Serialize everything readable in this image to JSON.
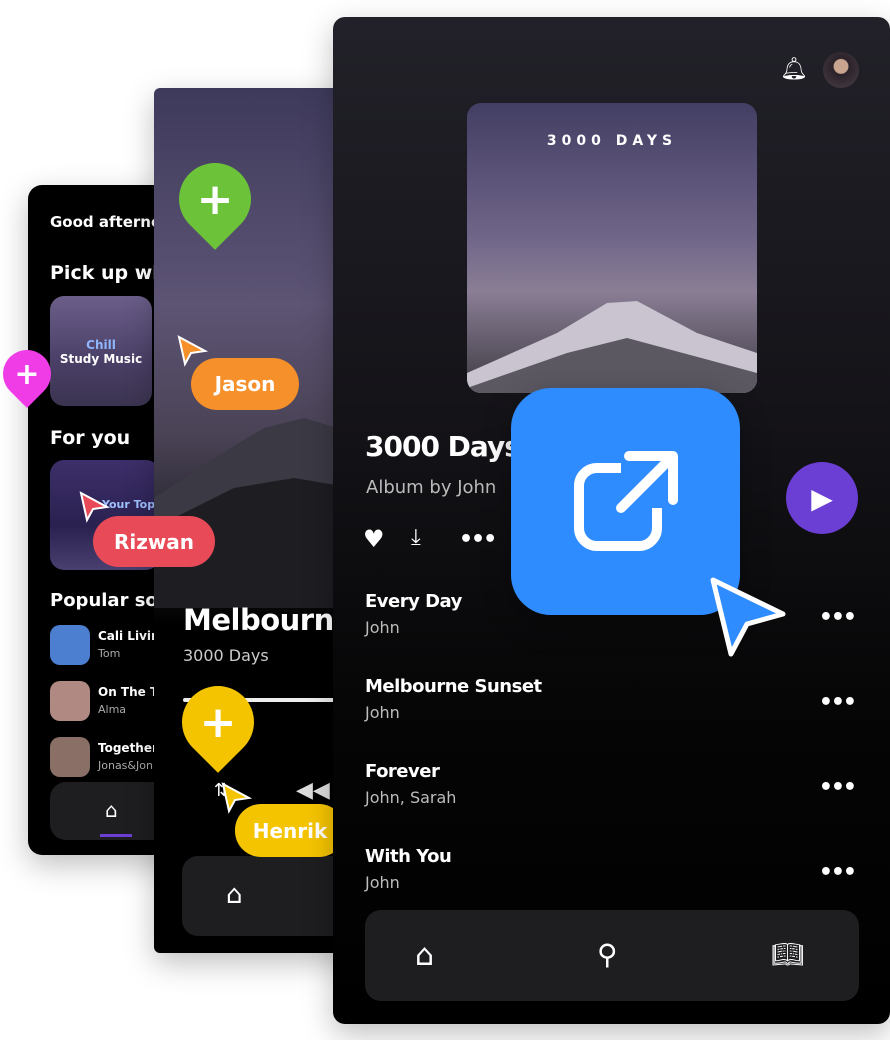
{
  "left_screen": {
    "greeting": "Good afternoon",
    "section_resume": "Pick up where you left off",
    "card_chill_line1": "Chill",
    "card_chill_line2": "Study Music",
    "section_for_you": "For you",
    "card_top": "Your Top",
    "section_popular": "Popular songs",
    "songs": [
      {
        "title": "Cali Living",
        "artist": "Tom"
      },
      {
        "title": "On The Top",
        "artist": "Alma"
      },
      {
        "title": "Together",
        "artist": "Jonas&Jon"
      }
    ],
    "nav_icon": "home-icon"
  },
  "mid_screen": {
    "title": "Melbourne Sunset",
    "subtitle": "3000 Days",
    "nav_icon": "home-icon"
  },
  "right_screen": {
    "album_art_text": "3000 DAYS",
    "album_title": "3000 Days",
    "album_subtitle": "Album by John",
    "tracks": [
      {
        "title": "Every Day",
        "artist": "John"
      },
      {
        "title": "Melbourne Sunset",
        "artist": "John"
      },
      {
        "title": "Forever",
        "artist": "John, Sarah"
      },
      {
        "title": "With You",
        "artist": "John"
      }
    ],
    "nav": [
      "home-icon",
      "search-icon",
      "book-icon"
    ],
    "accent": "#6b3fd4"
  },
  "collaborators": [
    {
      "name": "Jason",
      "color": "#f5902a"
    },
    {
      "name": "Rizwan",
      "color": "#e84b57"
    },
    {
      "name": "Henrik",
      "color": "#f5c400"
    }
  ],
  "share_tile_color": "#2f8cff"
}
